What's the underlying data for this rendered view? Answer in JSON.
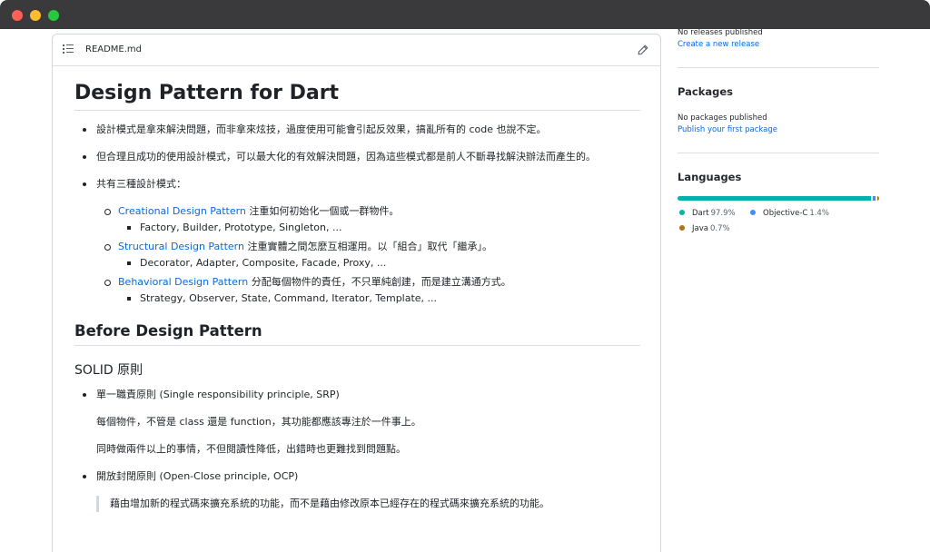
{
  "readme": {
    "filename": "README.md",
    "title": "Design Pattern for Dart",
    "intro_bullets": [
      "設計模式是拿來解決問題，而非拿來炫技，過度使用可能會引起反效果，搞亂所有的 code 也說不定。",
      "但合理且成功的使用設計模式，可以最大化的有效解決問題，因為這些模式都是前人不斷尋找解決辦法而產生的。",
      "共有三種設計模式："
    ],
    "pattern_types": [
      {
        "link": "Creational Design Pattern",
        "desc": " 注重如何初始化一個或一群物件。",
        "examples": "Factory, Builder, Prototype, Singleton, ..."
      },
      {
        "link": "Structural Design Pattern",
        "desc": " 注重實體之間怎麼互相運用。以「組合」取代「繼承」。",
        "examples": "Decorator, Adapter, Composite, Facade, Proxy, ..."
      },
      {
        "link": "Behavioral Design Pattern",
        "desc": " 分配每個物件的責任，不只單純創建，而是建立溝通方式。",
        "examples": "Strategy, Observer, State, Command, Iterator, Template, ..."
      }
    ],
    "section_before": "Before Design Pattern",
    "section_solid": "SOLID 原則",
    "srp": {
      "title": "單一職責原則 (Single responsibility principle, SRP)",
      "p1": "每個物件，不管是 class 還是 function，其功能都應該專注於一件事上。",
      "p2": "同時做兩件以上的事情，不但閱讀性降低，出錯時也更難找到問題點。"
    },
    "ocp": {
      "title": "開放封閉原則 (Open-Close principle, OCP)",
      "quote": "藉由增加新的程式碼來擴充系統的功能，而不是藉由修改原本已經存在的程式碼來擴充系統的功能。"
    }
  },
  "sidebar": {
    "releases": {
      "status": "No releases published",
      "link": "Create a new release"
    },
    "packages": {
      "title": "Packages",
      "status": "No packages published",
      "link": "Publish your first package"
    },
    "languages": {
      "title": "Languages",
      "items": [
        {
          "name": "Dart",
          "percent": "97.9%",
          "value": 97.9,
          "color": "#00b4ab"
        },
        {
          "name": "Objective-C",
          "percent": "1.4%",
          "value": 1.4,
          "color": "#438eff"
        },
        {
          "name": "Java",
          "percent": "0.7%",
          "value": 0.7,
          "color": "#b07219"
        }
      ]
    }
  },
  "icons": {
    "readme_list": "list-icon",
    "edit": "pencil-icon"
  }
}
